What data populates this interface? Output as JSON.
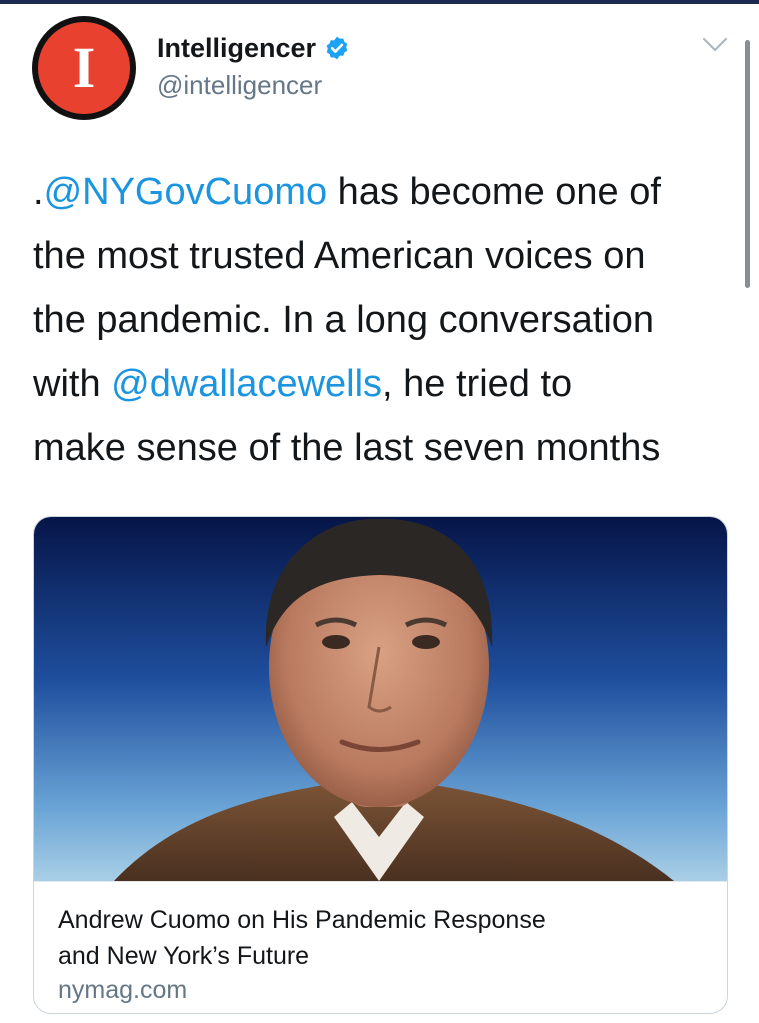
{
  "account": {
    "display_name": "Intelligencer",
    "handle": "@intelligencer",
    "avatar_letter": "I",
    "brand_color": "#e8412f"
  },
  "tweet": {
    "lines": [
      [
        {
          "text": ".",
          "mention": false
        },
        {
          "text": "@NYGovCuomo",
          "mention": true
        },
        {
          "text": " has become one of",
          "mention": false
        }
      ],
      [
        {
          "text": "the most trusted American voices on",
          "mention": false
        }
      ],
      [
        {
          "text": "the pandemic. In a long conversation",
          "mention": false
        }
      ],
      [
        {
          "text": "with ",
          "mention": false
        },
        {
          "text": "@dwallacewells",
          "mention": true
        },
        {
          "text": ", he tried to",
          "mention": false
        }
      ],
      [
        {
          "text": "make sense of the last seven months",
          "mention": false
        }
      ]
    ],
    "mention_color": "#1b95e0"
  },
  "card": {
    "title_line1": "Andrew Cuomo on His Pandemic Response",
    "title_line2": "and New York’s Future",
    "domain": "nymag.com",
    "image_subject": "portrait photo on blue gradient background"
  },
  "icons": [
    "verified-badge-icon",
    "chevron-down-icon"
  ]
}
